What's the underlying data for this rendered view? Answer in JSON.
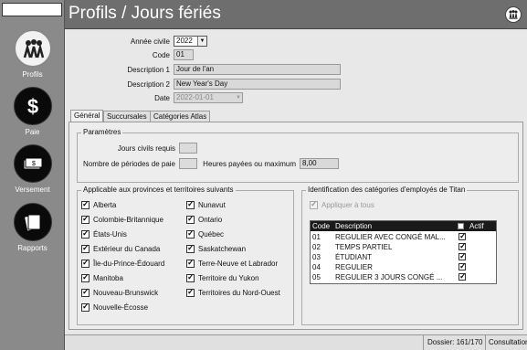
{
  "header": {
    "title": "Profils / Jours fériés"
  },
  "sidebar": {
    "items": [
      {
        "label": "Profils",
        "icon": "people-icon",
        "active": true
      },
      {
        "label": "Paie",
        "icon": "dollar-icon",
        "active": false
      },
      {
        "label": "Versement",
        "icon": "banknotes-icon",
        "active": false
      },
      {
        "label": "Rapports",
        "icon": "reports-icon",
        "active": false
      }
    ]
  },
  "form": {
    "annee_label": "Année civile",
    "annee_value": "2022",
    "code_label": "Code",
    "code_value": "01",
    "desc1_label": "Description 1",
    "desc1_value": "Jour de l'an",
    "desc2_label": "Description 2",
    "desc2_value": "New Year's Day",
    "date_label": "Date",
    "date_value": "2022-01-01"
  },
  "tabs": [
    {
      "label": "Général",
      "active": true
    },
    {
      "label": "Succursales",
      "active": false
    },
    {
      "label": "Catégories Atlas",
      "active": false
    }
  ],
  "parametres": {
    "title": "Paramètres",
    "jours_label": "Jours civils requis",
    "jours_value": "",
    "periodes_label": "Nombre de périodes de paie",
    "periodes_value": "",
    "heures_label": "Heures payées ou maximum",
    "heures_value": "8,00"
  },
  "provinces": {
    "title": "Applicable aux provinces et territoires suivants",
    "col1": [
      "Alberta",
      "Colombie-Britannique",
      "États-Unis",
      "Extérieur du Canada",
      "Île-du-Prince-Édouard",
      "Manitoba",
      "Nouveau-Brunswick",
      "Nouvelle-Écosse"
    ],
    "col2": [
      "Nunavut",
      "Ontario",
      "Québec",
      "Saskatchewan",
      "Terre-Neuve et Labrador",
      "Territoire du Yukon",
      "Territoires du Nord-Ouest"
    ]
  },
  "categories": {
    "title": "Identification des catégories d'employés de Titan",
    "apply_all_label": "Appliquer à tous",
    "columns": {
      "code": "Code",
      "description": "Description",
      "actif": "Actif"
    },
    "rows": [
      {
        "code": "01",
        "description": "REGULIER AVEC CONGÉ MAL...",
        "actif": true
      },
      {
        "code": "02",
        "description": "TEMPS PARTIEL",
        "actif": true
      },
      {
        "code": "03",
        "description": "ÉTUDIANT",
        "actif": true
      },
      {
        "code": "04",
        "description": "REGULIER",
        "actif": true
      },
      {
        "code": "05",
        "description": "REGULIER 3 JOURS CONGÉ ...",
        "actif": true
      }
    ]
  },
  "status": {
    "dossier": "Dossier: 161/170",
    "mode": "Consultation"
  }
}
